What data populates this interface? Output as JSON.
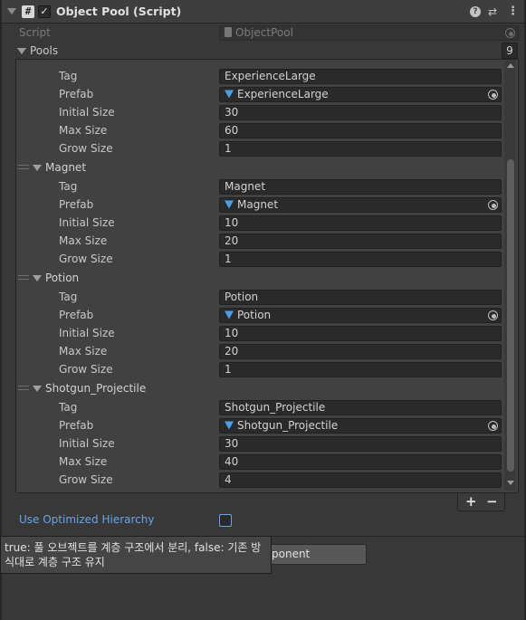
{
  "header": {
    "script_glyph": "#",
    "enabled_check": "✓",
    "title": "Object Pool (Script)",
    "help_glyph": "?",
    "preset_glyph": "⇄",
    "menu_glyph": "⋮"
  },
  "script_row": {
    "label": "Script",
    "value": "ObjectPool"
  },
  "pools": {
    "label": "Pools",
    "count": "9",
    "add_label": "+",
    "remove_label": "−",
    "partial_element": {
      "tag": "ExperienceLarge",
      "prefab": "ExperienceLarge",
      "initial_size": "30",
      "max_size": "60",
      "grow_size": "1"
    },
    "elements": [
      {
        "name": "Magnet",
        "tag": "Magnet",
        "prefab": "Magnet",
        "initial_size": "10",
        "max_size": "20",
        "grow_size": "1"
      },
      {
        "name": "Potion",
        "tag": "Potion",
        "prefab": "Potion",
        "initial_size": "10",
        "max_size": "20",
        "grow_size": "1"
      },
      {
        "name": "Shotgun_Projectile",
        "tag": "Shotgun_Projectile",
        "prefab": "Shotgun_Projectile",
        "initial_size": "30",
        "max_size": "40",
        "grow_size": "4"
      }
    ]
  },
  "field_labels": {
    "tag": "Tag",
    "prefab": "Prefab",
    "initial_size": "Initial Size",
    "max_size": "Max Size",
    "grow_size": "Grow Size"
  },
  "use_optimized": {
    "label": "Use Optimized Hierarchy",
    "checked": false
  },
  "add_component": {
    "visible_text": "ponent"
  },
  "tooltip": {
    "text": "true: 풀 오브젝트를 계층 구조에서 분리, false: 기존 방식대로 계층 구조 유지"
  },
  "colors": {
    "background": "#383838",
    "list_background": "#414141",
    "field_background": "#2a2a2a",
    "accent_blue": "#6aa4e6",
    "prefab_icon": "#4aa0e6"
  }
}
